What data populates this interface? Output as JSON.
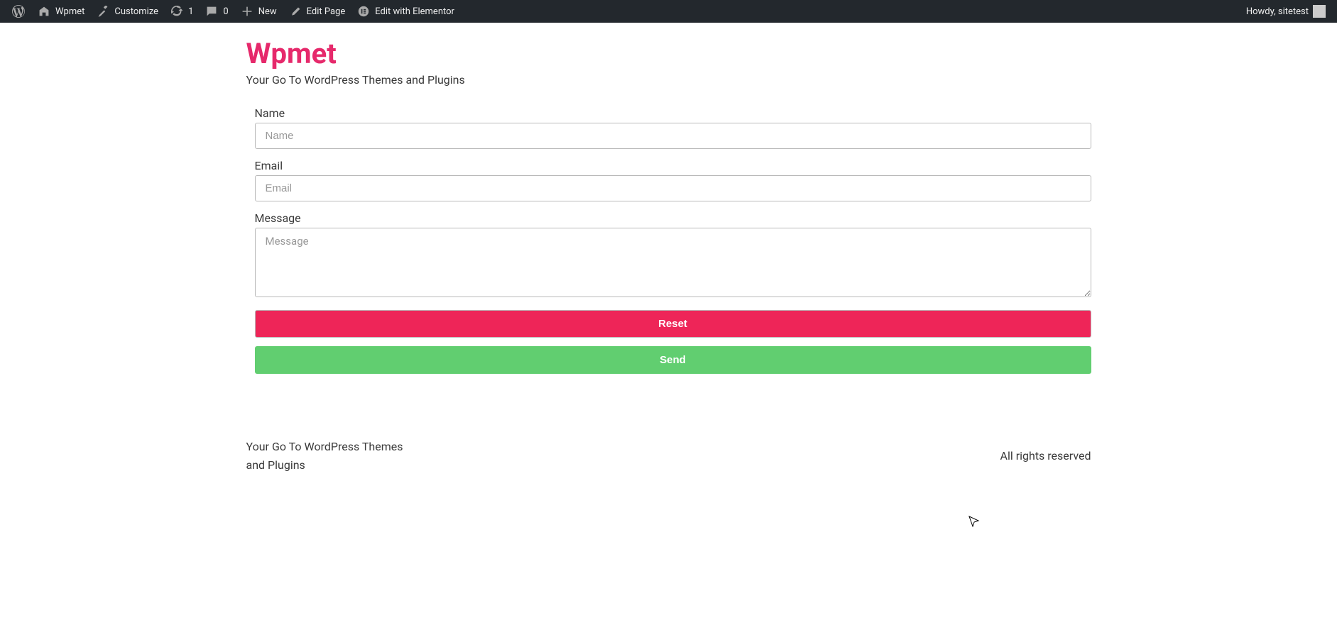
{
  "admin_bar": {
    "site_name": "Wpmet",
    "customize": "Customize",
    "updates_count": "1",
    "comments_count": "0",
    "new": "New",
    "edit_page": "Edit Page",
    "edit_elementor": "Edit with Elementor",
    "howdy": "Howdy, sitetest"
  },
  "site": {
    "title": "Wpmet",
    "tagline": "Your Go To WordPress Themes and Plugins"
  },
  "form": {
    "name_label": "Name",
    "name_placeholder": "Name",
    "email_label": "Email",
    "email_placeholder": "Email",
    "message_label": "Message",
    "message_placeholder": "Message",
    "reset_label": "Reset",
    "send_label": "Send"
  },
  "footer": {
    "left": "Your Go To WordPress Themes and Plugins",
    "right": "All rights reserved"
  }
}
